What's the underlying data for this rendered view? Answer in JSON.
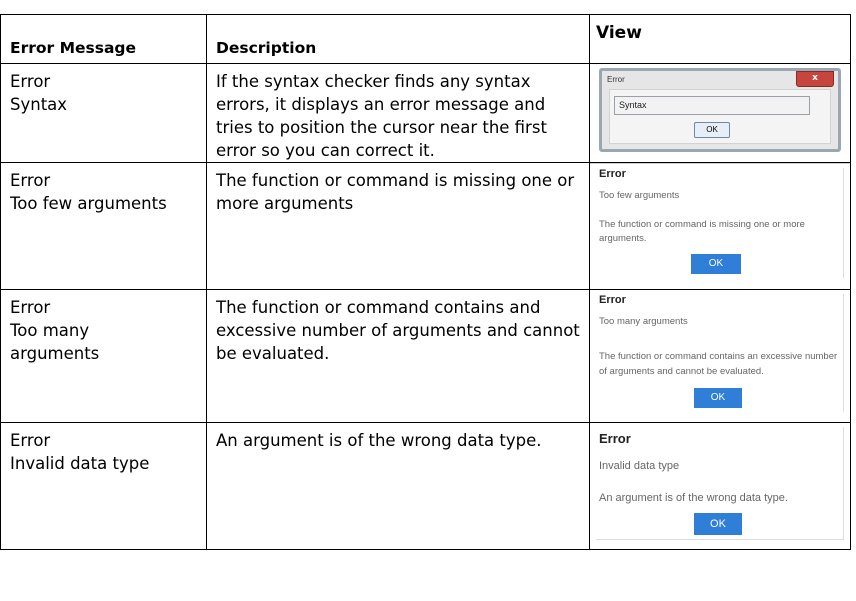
{
  "headers": {
    "error_message": "Error Message",
    "description": "Description",
    "view": "View"
  },
  "rows": [
    {
      "message_line1": "Error",
      "message_line2": "Syntax",
      "description": "If the syntax checker finds any syntax errors, it displays an error message and tries to position the cursor near the first error so you can correct it.",
      "view": {
        "title": "Error",
        "close": "x",
        "field": "Syntax",
        "ok": "OK"
      }
    },
    {
      "message_line1": "Error",
      "message_line2": "Too few arguments",
      "description": "The function or command is missing one or more arguments",
      "view": {
        "title": "Error",
        "subtitle": "Too few arguments",
        "message": "The function or command is missing one or more arguments.",
        "ok": "OK"
      }
    },
    {
      "message_line1": "Error",
      "message_line2": "Too many arguments",
      "description": "The function or command contains and excessive number of arguments and cannot be evaluated.",
      "view": {
        "title": "Error",
        "subtitle": "Too many arguments",
        "message": "The function or command contains an excessive number of arguments and cannot be evaluated.",
        "ok": "OK"
      }
    },
    {
      "message_line1": "Error",
      "message_line2": "Invalid data type",
      "description": "An argument is of the wrong data type.",
      "view": {
        "title": "Error",
        "subtitle": "Invalid data type",
        "message": "An argument is of the wrong data type.",
        "ok": "OK"
      }
    }
  ]
}
